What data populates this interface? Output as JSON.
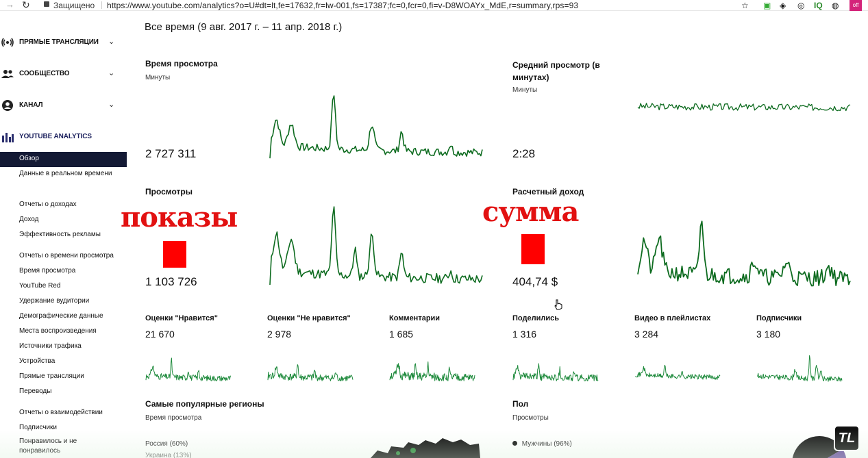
{
  "browser": {
    "secure_label": "Защищено",
    "url": "https://www.youtube.com/analytics?o=U#dt=lt,fe=17632,fr=lw-001,fs=17387;fc=0,fcr=0,fi=v-D8WOAYx_MdE,r=summary,rps=93",
    "ext_badge": "off"
  },
  "sidebar": {
    "sections": [
      {
        "label": "ПРЯМЫЕ ТРАНСЛЯЦИИ",
        "icon": "broadcast-icon"
      },
      {
        "label": "СООБЩЕСТВО",
        "icon": "people-icon"
      },
      {
        "label": "КАНАЛ",
        "icon": "account-icon"
      },
      {
        "label": "YOUTUBE ANALYTICS",
        "icon": "analytics-bars-icon"
      }
    ],
    "items": [
      "Обзор",
      "Данные в реальном времени",
      "Отчеты о доходах",
      "Доход",
      "Эффективность рекламы",
      "Отчеты о времени просмотра",
      "Время просмотра",
      "YouTube Red",
      "Удержание вудитории",
      "Демографические данные",
      "Места воспроизведения",
      "Источники трафика",
      "Устройства",
      "Прямые трансляции",
      "Переводы",
      "Отчеты о взаимодействии",
      "Подписчики",
      "Понравилось и не понравилось"
    ]
  },
  "main": {
    "date_range": "Все время (9 авг. 2017 г. – 11 апр. 2018 г.)",
    "metrics": [
      {
        "title": "Время просмотра",
        "subtitle": "Минуты",
        "value": "2 727 311"
      },
      {
        "title": "Средний просмотр (в минутах)",
        "subtitle": "Минуты",
        "value": "2:28"
      },
      {
        "title": "Просмотры",
        "subtitle": "",
        "value": "1 103 726"
      },
      {
        "title": "Расчетный доход",
        "subtitle": "",
        "value": "404,74 $"
      }
    ],
    "small_metrics": [
      {
        "title": "Оценки \"Нравится\"",
        "value": "21 670"
      },
      {
        "title": "Оценки \"Не нравится\"",
        "value": "2 978"
      },
      {
        "title": "Комментарии",
        "value": "1 685"
      },
      {
        "title": "Поделились",
        "value": "1 316"
      },
      {
        "title": "Видео в плейлистах",
        "value": "3 284"
      },
      {
        "title": "Подписчики",
        "value": "3 180"
      }
    ],
    "regions": {
      "title": "Самые популярные регионы",
      "subtitle": "Время просмотра",
      "rows": [
        {
          "name": "Россия",
          "pct": "(60%)"
        },
        {
          "name": "Украина",
          "pct": "(13%)"
        }
      ]
    },
    "gender": {
      "title": "Пол",
      "subtitle": "Просмотры",
      "rows": [
        {
          "name": "Мужчины",
          "pct": "(96%)"
        }
      ]
    }
  },
  "overlays": {
    "left_word": "показы",
    "right_word": "сумма",
    "red_color": "#ff0000"
  },
  "watermark": "TL",
  "colors": {
    "spark_green": "#0d6b1f",
    "small_spark_green": "#1e8a3c",
    "active_nav": "#141a35"
  }
}
